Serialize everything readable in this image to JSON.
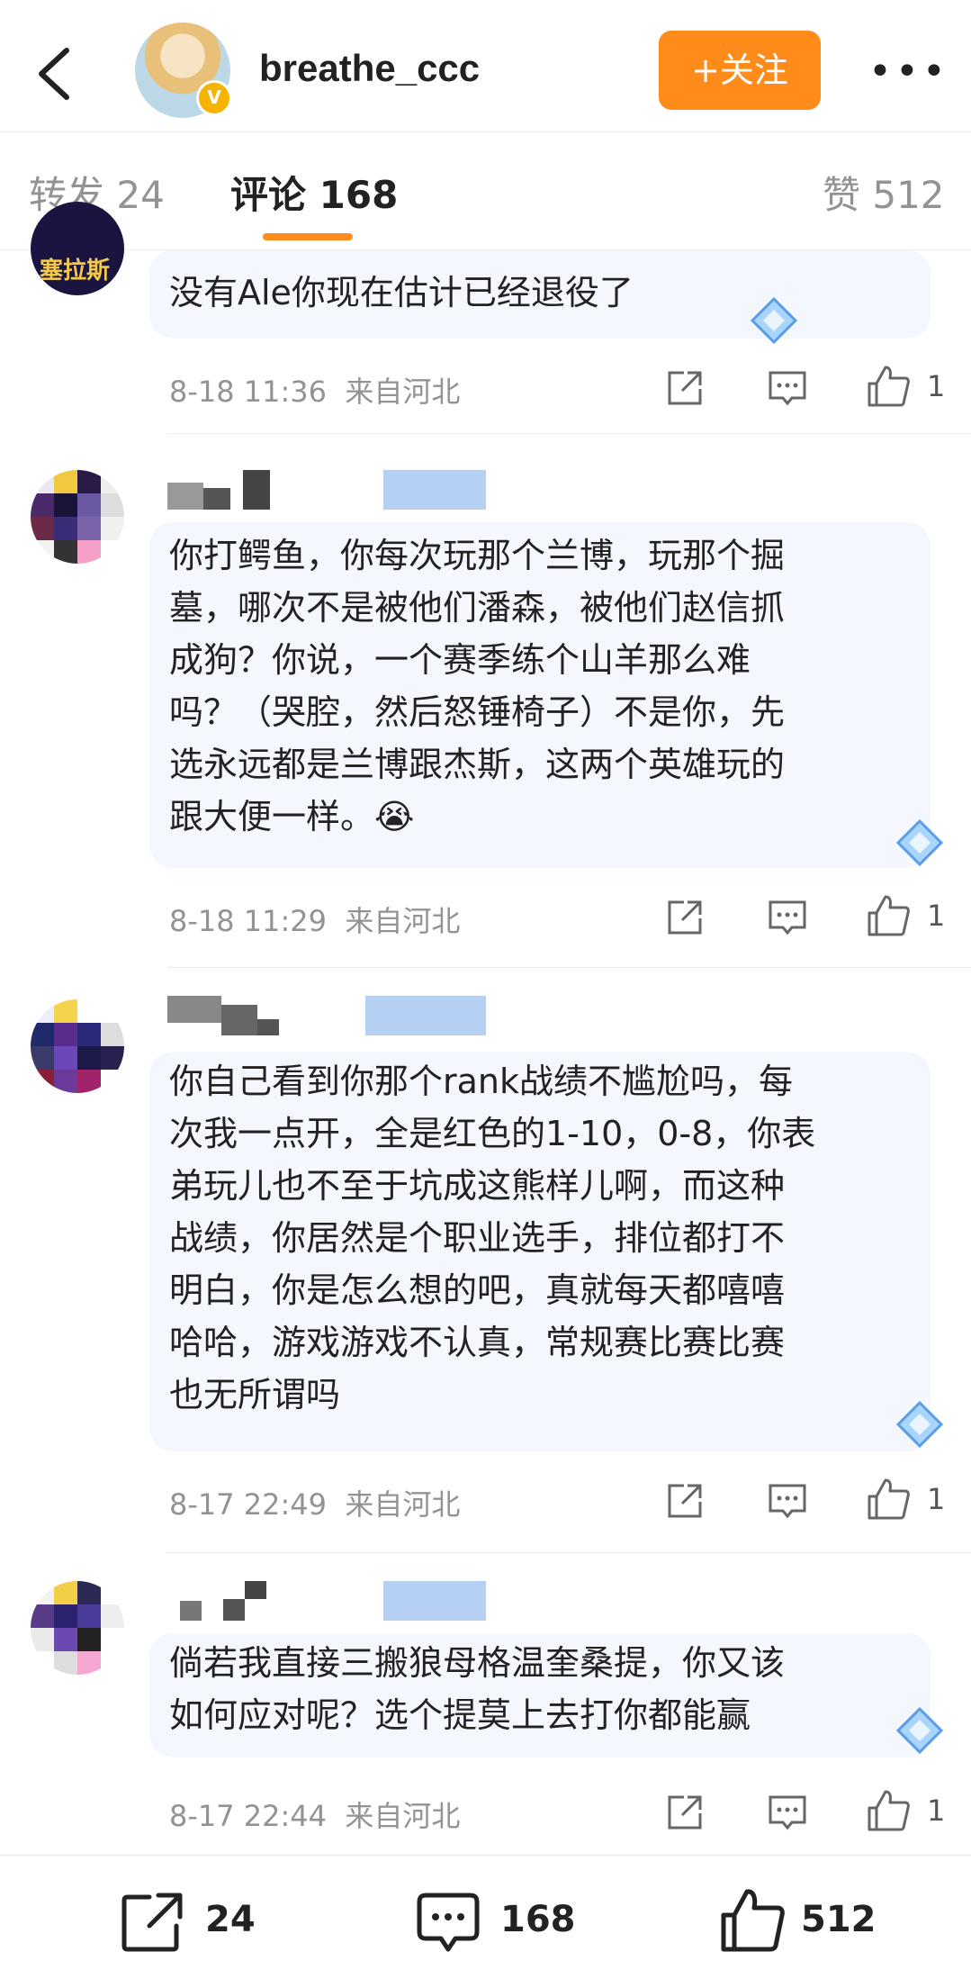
{
  "header": {
    "username": "breathe_ccc",
    "follow_label": "+关注",
    "more_label": "•••",
    "verified_badge": "V"
  },
  "tabs": [
    {
      "label": "转发 24",
      "active": false
    },
    {
      "label": "评论 168",
      "active": true
    },
    {
      "label": "赞 512",
      "active": false
    }
  ],
  "comments": [
    {
      "text": "没有Ale你现在估计已经退役了",
      "time": "8-18 11:36",
      "location": "来自河北",
      "likes": "1",
      "avatar_text": "塞拉斯"
    },
    {
      "text": "你打鳄鱼，你每次玩那个兰博，玩那个掘\n墓，哪次不是被他们潘森，被他们赵信抓\n成狗？你说，一个赛季练个山羊那么难\n吗？（哭腔，然后怒锤椅子）不是你，先\n选永远都是兰博跟杰斯，这两个英雄玩的\n跟大便一样。😭",
      "time": "8-18 11:29",
      "location": "来自河北",
      "likes": "1"
    },
    {
      "text": "你自己看到你那个rank战绩不尴尬吗，每\n次我一点开，全是红色的1-10，0-8，你表\n弟玩儿也不至于坑成这熊样儿啊，而这种\n战绩，你居然是个职业选手，排位都打不\n明白，你是怎么想的吧，真就每天都嘻嘻\n哈哈，游戏游戏不认真，常规赛比赛比赛\n也无所谓吗",
      "time": "8-17 22:49",
      "location": "来自河北",
      "likes": "1"
    },
    {
      "text": "倘若我直接三搬狼母格温奎桑提，你又该\n如何应对呢？选个提莫上去打你都能赢",
      "time": "8-17 22:44",
      "location": "来自河北",
      "likes": "1"
    }
  ],
  "bottom_bar": {
    "repost_count": "24",
    "comment_count": "168",
    "like_count": "512"
  },
  "colors": {
    "accent": "#ff8c1a",
    "bubble": "#f4f8fe",
    "meta": "#939393"
  },
  "icons": [
    "back-icon",
    "verified-icon",
    "more-icon",
    "share-icon",
    "comment-icon",
    "like-icon",
    "diamond-icon"
  ]
}
